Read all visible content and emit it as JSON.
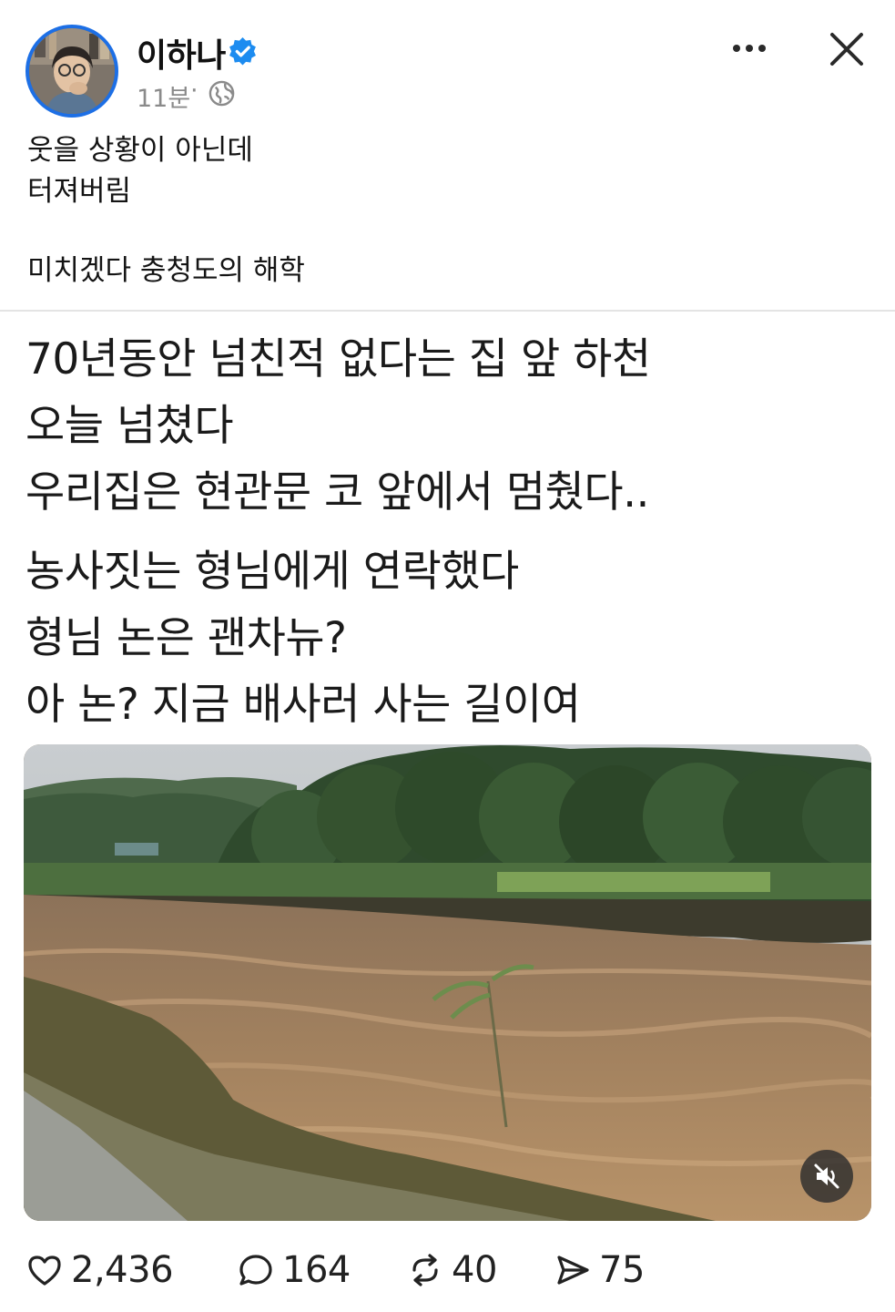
{
  "post": {
    "author": {
      "name": "이하나",
      "verified_icon": "verified-badge-icon",
      "avatar_icon": "avatar"
    },
    "meta": {
      "time": "11분",
      "separator": "·",
      "visibility_icon": "globe-icon"
    },
    "caption_lines": [
      "웃을 상황이 아닌데",
      "터져버림",
      "미치겠다 충청도의 해학"
    ],
    "body_lines": [
      "70년동안 넘친적 없다는 집 앞 하천",
      "오늘 넘쳤다",
      "우리집은 현관문 코 앞에서 멈췄다..",
      "농사짓는 형님에게 연락했다",
      "형님 논은 괜차뉴?",
      "아 논? 지금 배사러 사는 길이여"
    ],
    "media": {
      "kind": "video",
      "mute_icon": "speaker-muted-icon"
    },
    "actions": {
      "likes": "2,436",
      "replies": "164",
      "reposts": "40",
      "shares": "75"
    }
  },
  "colors": {
    "accent": "#1d6fe5",
    "text": "#111111",
    "muted": "#8a8a8a",
    "divider": "#e4e4e4"
  }
}
